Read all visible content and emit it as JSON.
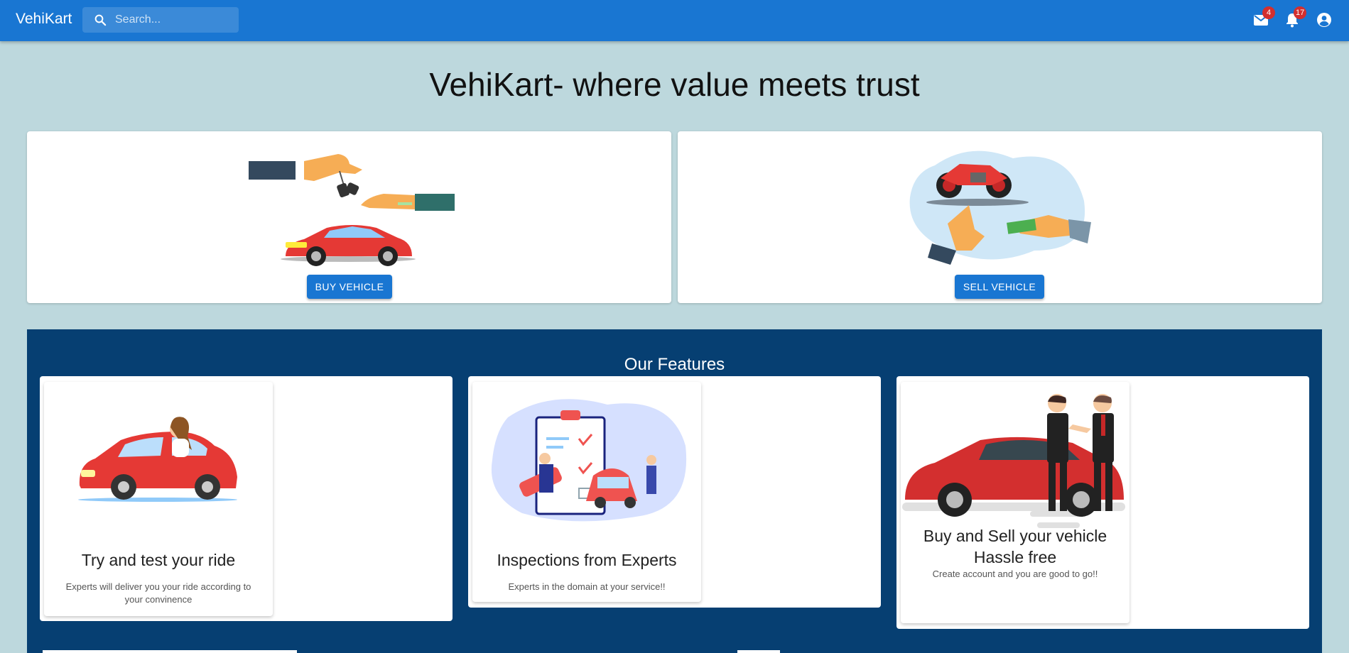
{
  "appbar": {
    "brand": "VehiKart",
    "search_placeholder": "Search...",
    "mail_count": "4",
    "notification_count": "17",
    "colors": {
      "primary": "#1976d2",
      "badge": "#d32f2f"
    }
  },
  "hero": {
    "headline": "VehiKart- where value meets trust"
  },
  "actions": {
    "buy_label": "BUY VEHICLE",
    "sell_label": "SELL VEHICLE"
  },
  "features": {
    "title": "Our Features",
    "background": "#063f72",
    "items": [
      {
        "icon": "woman-driving-car-illustration",
        "title": "Try and test your ride",
        "desc": "Experts will deliver you your ride according to your convinence"
      },
      {
        "icon": "inspection-checklist-illustration",
        "title": "Inspections from Experts",
        "desc": "Experts in the domain at your service!!"
      },
      {
        "icon": "handshake-car-deal-illustration",
        "title": "Buy and Sell your vehicle Hassle free",
        "desc": "Create account and you are good to go!!"
      }
    ]
  }
}
